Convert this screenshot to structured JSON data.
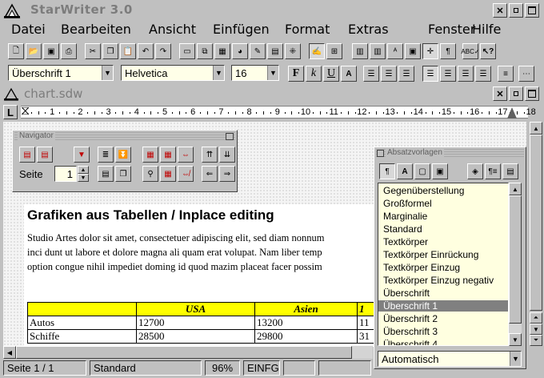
{
  "app": {
    "title": "StarWriter 3.0"
  },
  "menu": {
    "items": [
      "Datei",
      "Bearbeiten",
      "Ansicht",
      "Einfügen",
      "Format",
      "Extras",
      "Fenster",
      "Hilfe"
    ]
  },
  "format_bar": {
    "style_value": "Überschrift 1",
    "font_value": "Helvetica",
    "size_value": "16"
  },
  "document": {
    "filename": "chart.sdw",
    "heading": "Grafiken aus Tabellen / Inplace editing",
    "body_lines": [
      "Studio Artes dolor sit amet, consectetuer adipiscing elit, sed diam nonnum",
      "inci dunt ut labore et dolore magna ali quam erat volupat. Nam liber temp",
      "option congue nihil impediet doming id quod mazim placeat facer possim"
    ],
    "table": {
      "headers": [
        "",
        "USA",
        "Asien",
        "1"
      ],
      "rows": [
        [
          "Autos",
          "12700",
          "13200",
          "11"
        ],
        [
          "Schiffe",
          "28500",
          "29800",
          "31"
        ]
      ]
    }
  },
  "ruler": {
    "numbers": [
      "1",
      "2",
      "3",
      "4",
      "5",
      "6",
      "7",
      "8",
      "9",
      "10",
      "11",
      "12",
      "13",
      "14",
      "15",
      "16",
      "17",
      "18"
    ]
  },
  "navigator": {
    "title": "Navigator",
    "page_label": "Seite",
    "page_value": "1"
  },
  "styles_window": {
    "title": "Absatzvorlagen",
    "items": [
      "Gegenüberstellung",
      "Großformel",
      "Marginalie",
      "Standard",
      "Textkörper",
      "Textkörper Einrückung",
      "Textkörper Einzug",
      "Textkörper Einzug negativ",
      "Überschrift",
      "Überschrift 1",
      "Überschrift 2",
      "Überschrift 3",
      "Überschrift 4"
    ],
    "selected": "Überschrift 1",
    "filter_value": "Automatisch"
  },
  "status": {
    "page": "Seite 1 / 1",
    "style": "Standard",
    "zoom": "96%",
    "mode": "EINFG"
  },
  "colors": {
    "style_list_bg": "#ffffe0",
    "selected_bg": "#808080",
    "table_header_bg": "#ffff00"
  }
}
